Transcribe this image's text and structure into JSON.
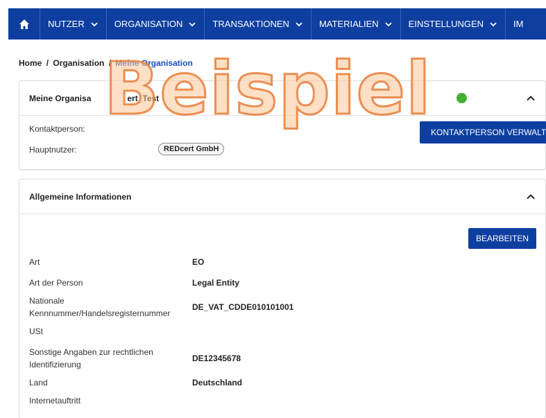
{
  "nav": {
    "items": [
      {
        "label": "NUTZER"
      },
      {
        "label": "ORGANISATION"
      },
      {
        "label": "TRANSAKTIONEN"
      },
      {
        "label": "MATERIALIEN"
      },
      {
        "label": "EINSTELLUNGEN"
      },
      {
        "label": "IM"
      }
    ]
  },
  "breadcrumb": {
    "home": "Home",
    "separator": "/",
    "middle": "Organisation",
    "current": "Meine Organisation"
  },
  "card1": {
    "title": "Meine Organisa",
    "title_tail": "ert_Test",
    "contact_label": "Kontaktperson:",
    "main_user_label": "Hauptnutzer:",
    "main_user_value": "REDcert GmbH",
    "contact_button": "KONTAKTPERSON VERWALTEN"
  },
  "card2": {
    "title": "Allgemeine Informationen",
    "edit_button": "BEARBEITEN",
    "rows": [
      {
        "label": "Art",
        "value": "EO"
      },
      {
        "label": "Art der Person",
        "value": "Legal Entity"
      },
      {
        "label": "Nationale Kennnummer/Handelsregisternummer",
        "value": "DE_VAT_CDDE010101001"
      },
      {
        "label": "USt",
        "value": ""
      },
      {
        "label": "Sonstige Angaben zur rechtlichen Identifizierung",
        "value": "DE12345678"
      },
      {
        "label": "Land",
        "value": "Deutschland"
      },
      {
        "label": "Internetauftritt",
        "value": ""
      }
    ]
  },
  "watermark": "Beispiel",
  "colors": {
    "nav_bg": "#0e3fa0",
    "link": "#1a4fc4",
    "status_ok": "#46b034",
    "watermark": "#e87e38"
  }
}
